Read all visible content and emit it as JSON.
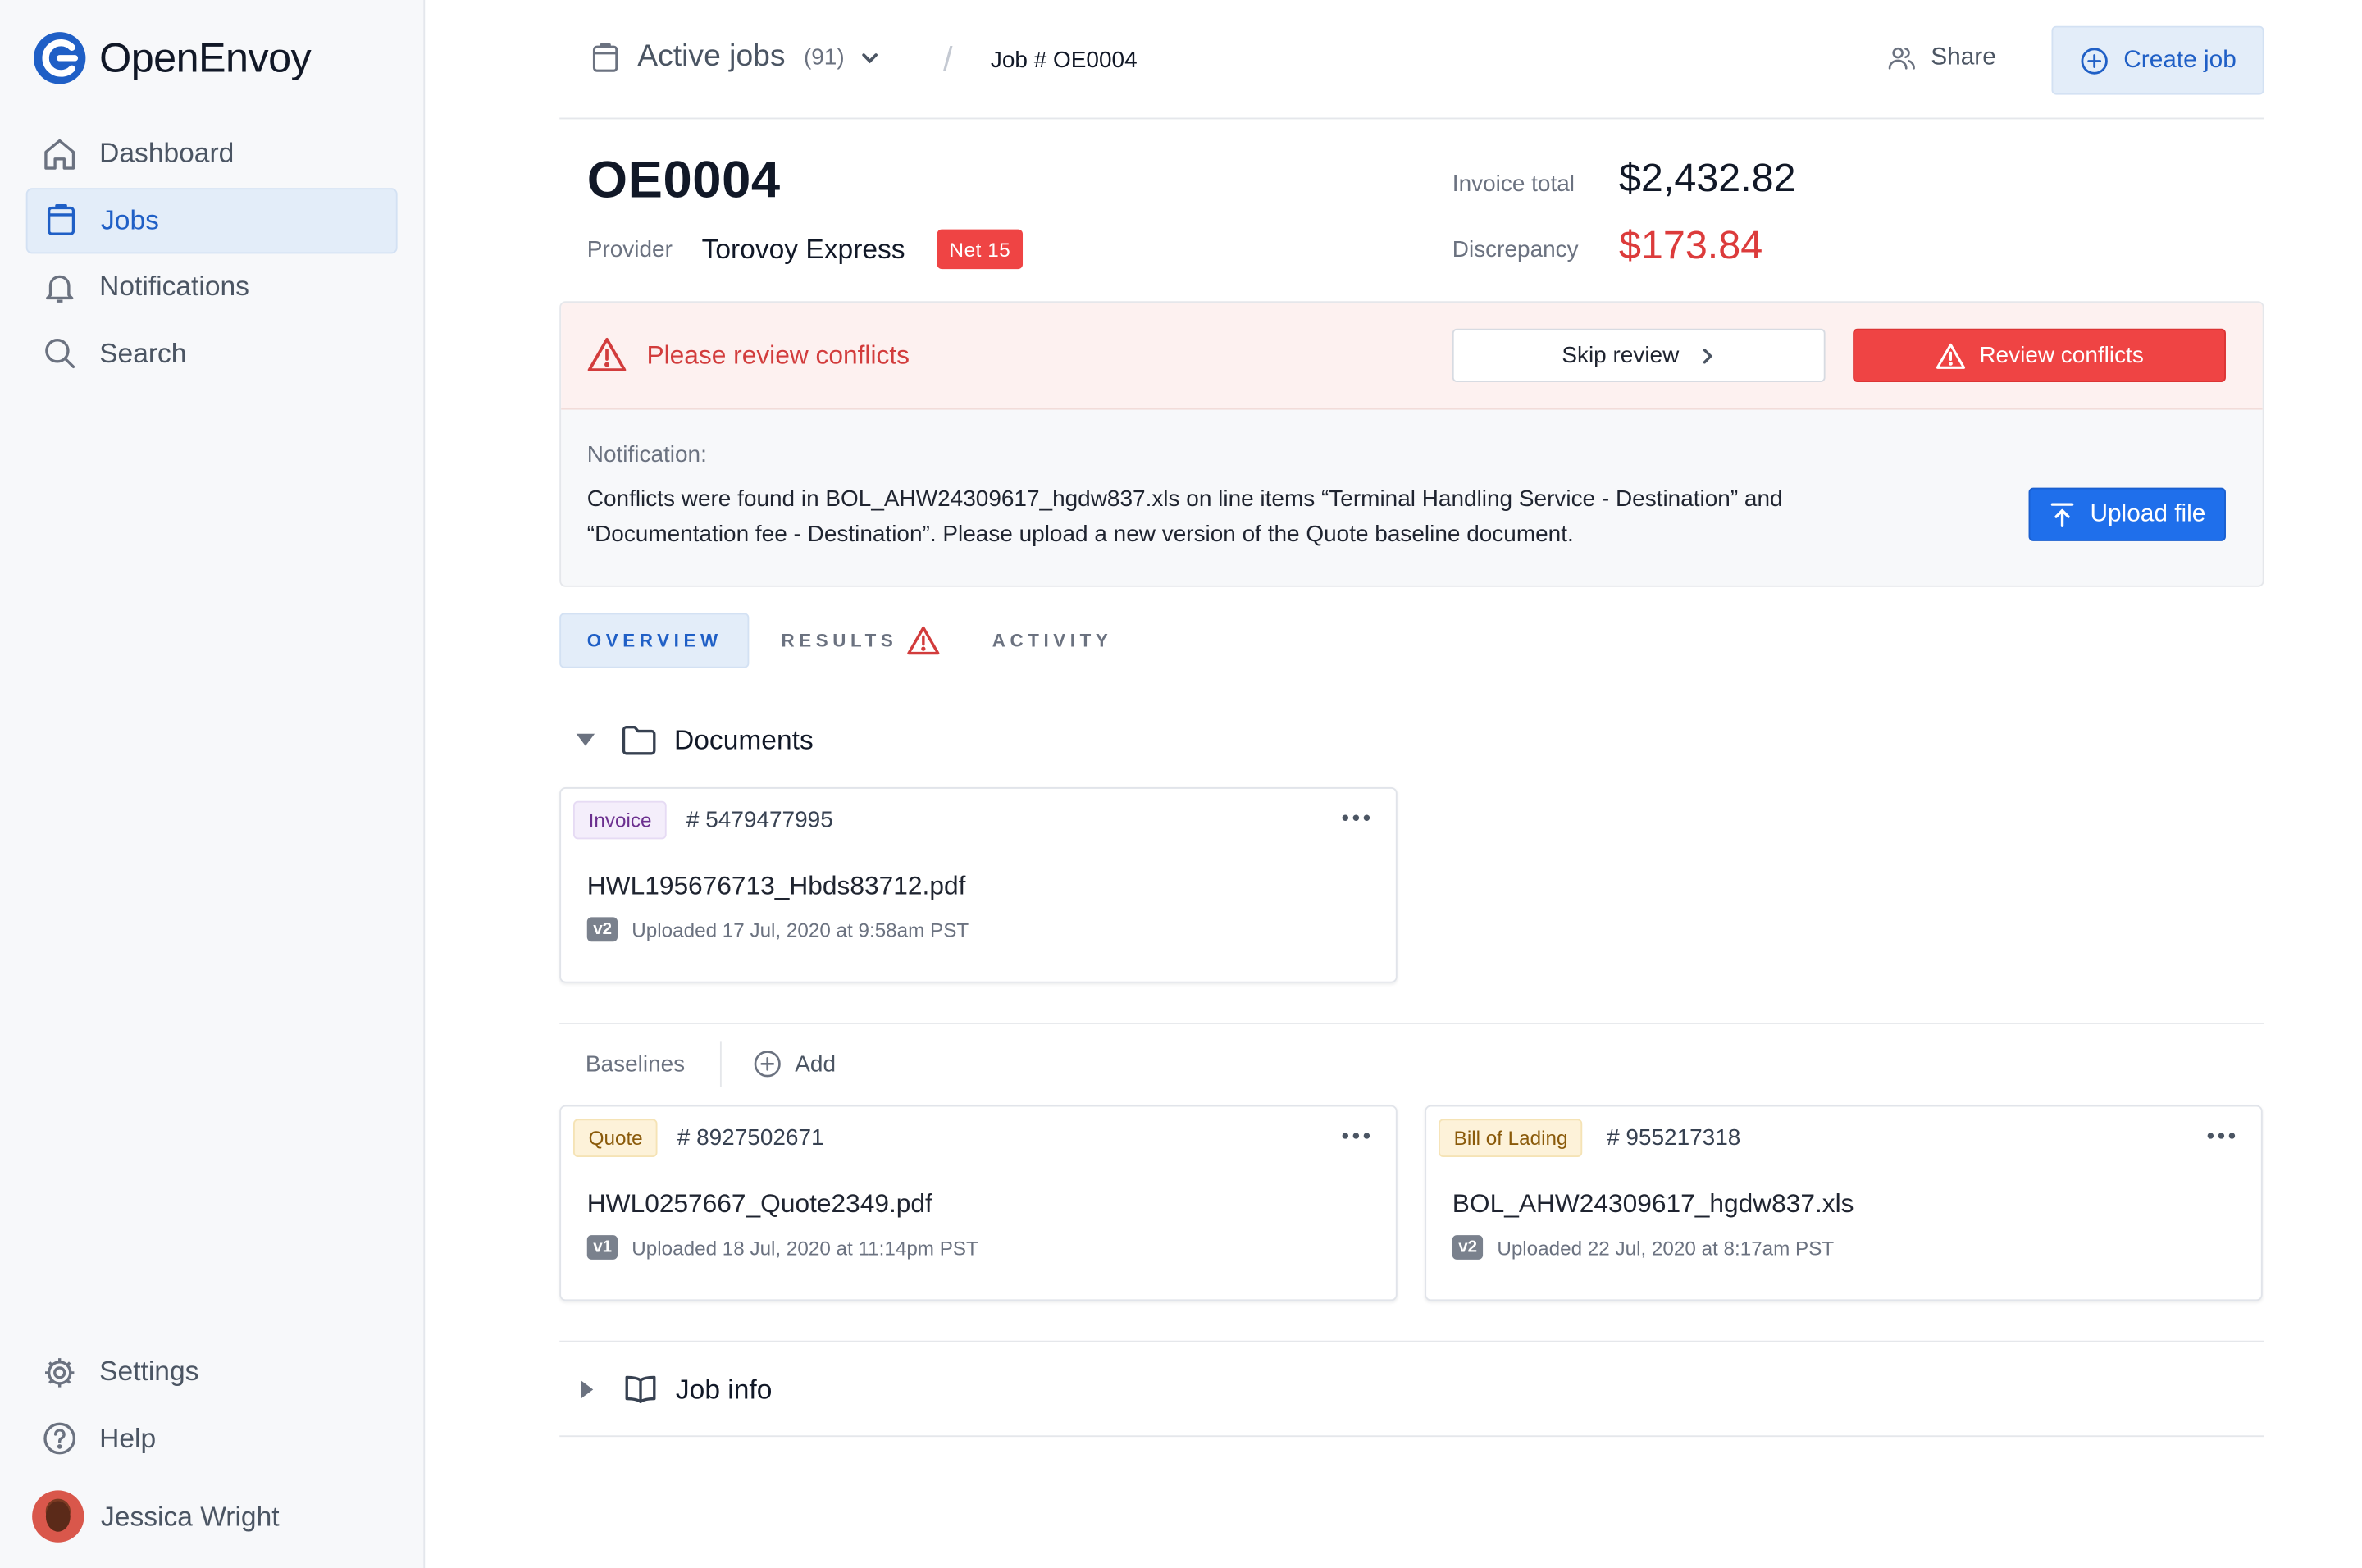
{
  "app": {
    "name": "OpenEnvoy",
    "brand_color": "#1f5fc6"
  },
  "sidebar": {
    "items": [
      {
        "label": "Dashboard",
        "icon": "home-icon"
      },
      {
        "label": "Jobs",
        "icon": "clipboard-icon",
        "active": true
      },
      {
        "label": "Notifications",
        "icon": "bell-icon"
      },
      {
        "label": "Search",
        "icon": "search-icon"
      }
    ],
    "bottom_items": [
      {
        "label": "Settings",
        "icon": "gear-icon"
      },
      {
        "label": "Help",
        "icon": "help-icon"
      }
    ],
    "user": {
      "name": "Jessica Wright"
    }
  },
  "header": {
    "breadcrumb_root": "Active jobs",
    "breadcrumb_count": "(91)",
    "breadcrumb_separator": "/",
    "breadcrumb_current": "Job # OE0004",
    "share_label": "Share",
    "create_label": "Create job"
  },
  "job": {
    "id": "OE0004",
    "provider_label": "Provider",
    "provider_name": "Torovoy Express",
    "terms_badge": "Net 15",
    "invoice_total_label": "Invoice total",
    "invoice_total": "$2,432.82",
    "discrepancy_label": "Discrepancy",
    "discrepancy": "$173.84"
  },
  "alert": {
    "title": "Please review conflicts",
    "skip_label": "Skip review",
    "review_label": "Review conflicts",
    "notification_label": "Notification:",
    "notification_text": "Conflicts were found in BOL_AHW24309617_hgdw837.xls on line items “Terminal Handling Service - Destination” and “Documentation fee - Destination”. Please upload a new version of the Quote baseline document.",
    "upload_label": "Upload file"
  },
  "tabs": [
    {
      "label": "OVERVIEW",
      "active": true
    },
    {
      "label": "RESULTS",
      "warning": true
    },
    {
      "label": "ACTIVITY"
    }
  ],
  "documents": {
    "title": "Documents",
    "invoice": {
      "tag": "Invoice",
      "number": "# 5479477995",
      "filename": "HWL195676713_Hbds83712.pdf",
      "version": "v2",
      "uploaded": "Uploaded 17 Jul, 2020 at 9:58am PST"
    }
  },
  "baselines": {
    "label": "Baselines",
    "add_label": "Add",
    "cards": [
      {
        "tag": "Quote",
        "number": "# 8927502671",
        "filename": "HWL0257667_Quote2349.pdf",
        "version": "v1",
        "uploaded": "Uploaded 18 Jul, 2020 at 11:14pm PST"
      },
      {
        "tag": "Bill of Lading",
        "number": "# 955217318",
        "filename": "BOL_AHW24309617_hgdw837.xls",
        "version": "v2",
        "uploaded": "Uploaded 22 Jul, 2020 at 8:17am PST"
      }
    ]
  },
  "job_info": {
    "title": "Job info"
  },
  "colors": {
    "danger": "#ef4444",
    "primary": "#1f6feb",
    "active_bg": "#e3edf9"
  }
}
